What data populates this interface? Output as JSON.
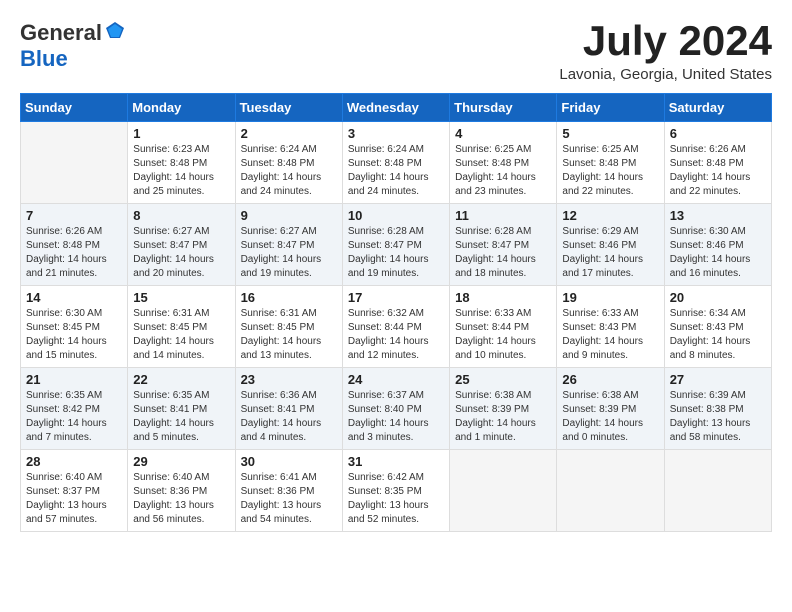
{
  "header": {
    "logo_general": "General",
    "logo_blue": "Blue",
    "month_year": "July 2024",
    "location": "Lavonia, Georgia, United States"
  },
  "calendar": {
    "columns": [
      "Sunday",
      "Monday",
      "Tuesday",
      "Wednesday",
      "Thursday",
      "Friday",
      "Saturday"
    ],
    "weeks": [
      [
        {
          "day": "",
          "info": ""
        },
        {
          "day": "1",
          "info": "Sunrise: 6:23 AM\nSunset: 8:48 PM\nDaylight: 14 hours\nand 25 minutes."
        },
        {
          "day": "2",
          "info": "Sunrise: 6:24 AM\nSunset: 8:48 PM\nDaylight: 14 hours\nand 24 minutes."
        },
        {
          "day": "3",
          "info": "Sunrise: 6:24 AM\nSunset: 8:48 PM\nDaylight: 14 hours\nand 24 minutes."
        },
        {
          "day": "4",
          "info": "Sunrise: 6:25 AM\nSunset: 8:48 PM\nDaylight: 14 hours\nand 23 minutes."
        },
        {
          "day": "5",
          "info": "Sunrise: 6:25 AM\nSunset: 8:48 PM\nDaylight: 14 hours\nand 22 minutes."
        },
        {
          "day": "6",
          "info": "Sunrise: 6:26 AM\nSunset: 8:48 PM\nDaylight: 14 hours\nand 22 minutes."
        }
      ],
      [
        {
          "day": "7",
          "info": "Sunrise: 6:26 AM\nSunset: 8:48 PM\nDaylight: 14 hours\nand 21 minutes."
        },
        {
          "day": "8",
          "info": "Sunrise: 6:27 AM\nSunset: 8:47 PM\nDaylight: 14 hours\nand 20 minutes."
        },
        {
          "day": "9",
          "info": "Sunrise: 6:27 AM\nSunset: 8:47 PM\nDaylight: 14 hours\nand 19 minutes."
        },
        {
          "day": "10",
          "info": "Sunrise: 6:28 AM\nSunset: 8:47 PM\nDaylight: 14 hours\nand 19 minutes."
        },
        {
          "day": "11",
          "info": "Sunrise: 6:28 AM\nSunset: 8:47 PM\nDaylight: 14 hours\nand 18 minutes."
        },
        {
          "day": "12",
          "info": "Sunrise: 6:29 AM\nSunset: 8:46 PM\nDaylight: 14 hours\nand 17 minutes."
        },
        {
          "day": "13",
          "info": "Sunrise: 6:30 AM\nSunset: 8:46 PM\nDaylight: 14 hours\nand 16 minutes."
        }
      ],
      [
        {
          "day": "14",
          "info": "Sunrise: 6:30 AM\nSunset: 8:45 PM\nDaylight: 14 hours\nand 15 minutes."
        },
        {
          "day": "15",
          "info": "Sunrise: 6:31 AM\nSunset: 8:45 PM\nDaylight: 14 hours\nand 14 minutes."
        },
        {
          "day": "16",
          "info": "Sunrise: 6:31 AM\nSunset: 8:45 PM\nDaylight: 14 hours\nand 13 minutes."
        },
        {
          "day": "17",
          "info": "Sunrise: 6:32 AM\nSunset: 8:44 PM\nDaylight: 14 hours\nand 12 minutes."
        },
        {
          "day": "18",
          "info": "Sunrise: 6:33 AM\nSunset: 8:44 PM\nDaylight: 14 hours\nand 10 minutes."
        },
        {
          "day": "19",
          "info": "Sunrise: 6:33 AM\nSunset: 8:43 PM\nDaylight: 14 hours\nand 9 minutes."
        },
        {
          "day": "20",
          "info": "Sunrise: 6:34 AM\nSunset: 8:43 PM\nDaylight: 14 hours\nand 8 minutes."
        }
      ],
      [
        {
          "day": "21",
          "info": "Sunrise: 6:35 AM\nSunset: 8:42 PM\nDaylight: 14 hours\nand 7 minutes."
        },
        {
          "day": "22",
          "info": "Sunrise: 6:35 AM\nSunset: 8:41 PM\nDaylight: 14 hours\nand 5 minutes."
        },
        {
          "day": "23",
          "info": "Sunrise: 6:36 AM\nSunset: 8:41 PM\nDaylight: 14 hours\nand 4 minutes."
        },
        {
          "day": "24",
          "info": "Sunrise: 6:37 AM\nSunset: 8:40 PM\nDaylight: 14 hours\nand 3 minutes."
        },
        {
          "day": "25",
          "info": "Sunrise: 6:38 AM\nSunset: 8:39 PM\nDaylight: 14 hours\nand 1 minute."
        },
        {
          "day": "26",
          "info": "Sunrise: 6:38 AM\nSunset: 8:39 PM\nDaylight: 14 hours\nand 0 minutes."
        },
        {
          "day": "27",
          "info": "Sunrise: 6:39 AM\nSunset: 8:38 PM\nDaylight: 13 hours\nand 58 minutes."
        }
      ],
      [
        {
          "day": "28",
          "info": "Sunrise: 6:40 AM\nSunset: 8:37 PM\nDaylight: 13 hours\nand 57 minutes."
        },
        {
          "day": "29",
          "info": "Sunrise: 6:40 AM\nSunset: 8:36 PM\nDaylight: 13 hours\nand 56 minutes."
        },
        {
          "day": "30",
          "info": "Sunrise: 6:41 AM\nSunset: 8:36 PM\nDaylight: 13 hours\nand 54 minutes."
        },
        {
          "day": "31",
          "info": "Sunrise: 6:42 AM\nSunset: 8:35 PM\nDaylight: 13 hours\nand 52 minutes."
        },
        {
          "day": "",
          "info": ""
        },
        {
          "day": "",
          "info": ""
        },
        {
          "day": "",
          "info": ""
        }
      ]
    ]
  }
}
